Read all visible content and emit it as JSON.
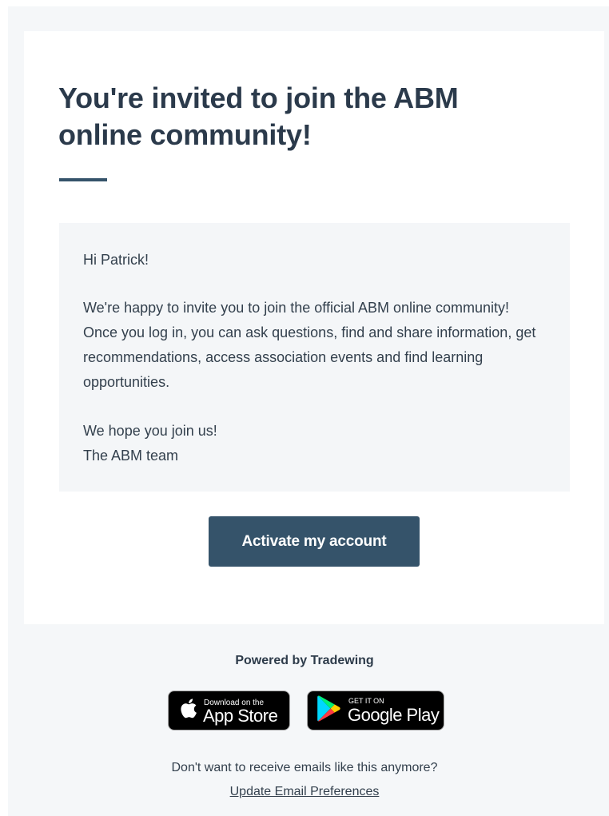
{
  "email": {
    "headline": "You're invited to join the ABM online community!",
    "greeting": "Hi Patrick!",
    "body": "We're happy to invite you to join the official ABM online community! Once you log in, you can ask questions, find and share information, get recommendations, access association events and find learning opportunities.",
    "closing": "We hope you join us!",
    "signature": "The ABM team",
    "cta_label": "Activate my account"
  },
  "footer": {
    "powered_by": "Powered by Tradewing",
    "app_store": {
      "small": "Download on the",
      "big": "App Store",
      "icon": "apple-icon"
    },
    "google_play": {
      "small": "GET IT ON",
      "big": "Google Play",
      "icon": "google-play-icon"
    },
    "unsubscribe_text": "Don't want to receive emails like this anymore?",
    "preferences_link": "Update Email Preferences"
  },
  "colors": {
    "page_background": "#f5f7f9",
    "card_background": "#ffffff",
    "message_box": "#f4f6f8",
    "accent": "#35536a",
    "text": "#2d3b4a"
  }
}
